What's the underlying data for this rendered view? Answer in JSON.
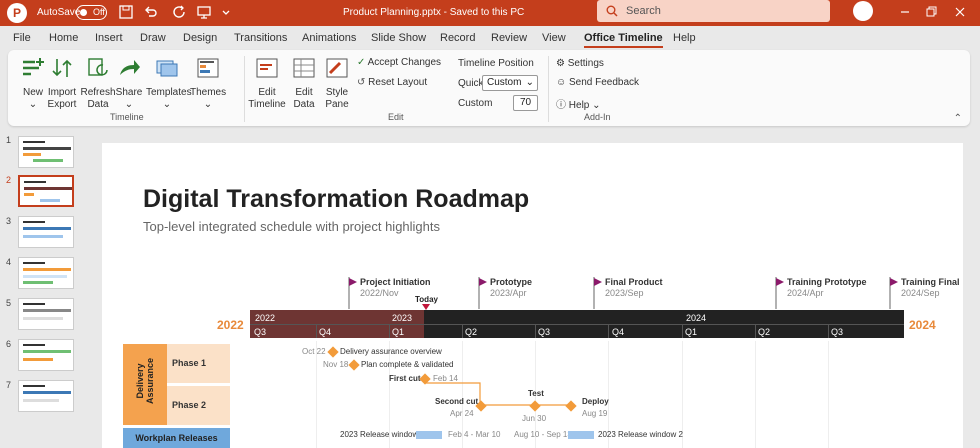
{
  "titlebar": {
    "app_letter": "P",
    "autosave_label": "AutoSave",
    "autosave_state": "Off",
    "document_title": "Product Planning.pptx - Saved to this PC",
    "search_placeholder": "Search"
  },
  "menu": [
    "File",
    "Home",
    "Insert",
    "Draw",
    "Design",
    "Transitions",
    "Animations",
    "Slide Show",
    "Record",
    "Review",
    "View",
    "Office Timeline",
    "Help"
  ],
  "active_menu": "Office Timeline",
  "ribbon": {
    "timeline_group": {
      "label": "Timeline",
      "buttons": [
        "New",
        "Import",
        "Refresh",
        "Share",
        "Templates",
        "Themes"
      ],
      "sublabels": {
        "new": "",
        "import": "Export",
        "refresh": "Data"
      }
    },
    "edit_group": {
      "label": "Edit",
      "buttons": [
        "Edit",
        "Edit",
        "Style"
      ],
      "sublabels": [
        "Timeline",
        "Data",
        "Pane"
      ],
      "accept_changes": "Accept Changes",
      "reset_layout": "Reset Layout",
      "timeline_position": "Timeline Position",
      "quick_label": "Quick",
      "quick_value": "Custom",
      "custom_label": "Custom",
      "custom_value": "70"
    },
    "addin_group": {
      "label": "Add-In",
      "settings": "Settings",
      "send_feedback": "Send Feedback",
      "help": "Help"
    }
  },
  "slides": [
    "1",
    "2",
    "3",
    "4",
    "5",
    "6",
    "7"
  ],
  "selected_slide": 2,
  "slide": {
    "title": "Digital Transformation Roadmap",
    "subtitle": "Top-level integrated schedule with project highlights",
    "milestones": [
      {
        "name": "Project Initiation",
        "date": "2022/Nov"
      },
      {
        "name": "Prototype",
        "date": "2023/Apr"
      },
      {
        "name": "Final Product",
        "date": "2023/Sep"
      },
      {
        "name": "Training Prototype",
        "date": "2024/Apr"
      },
      {
        "name": "Training Final",
        "date": "2024/Sep"
      }
    ],
    "today_label": "Today",
    "year_left": "2022",
    "year_right": "2024",
    "years": [
      "2022",
      "2023",
      "2024"
    ],
    "quarters": [
      "Q3",
      "Q4",
      "Q1",
      "Q2",
      "Q3",
      "Q4",
      "Q1",
      "Q2",
      "Q3"
    ],
    "swimlanes": [
      {
        "name": "Delivery Assurance",
        "phases": [
          "Phase 1",
          "Phase 2"
        ]
      },
      {
        "name": "Workplan Releases"
      }
    ],
    "tasks": [
      {
        "date": "Oct 22",
        "label": "Delivery assurance overview"
      },
      {
        "date": "Nov 18",
        "label": "Plan complete & validated"
      },
      {
        "date": "Feb 14",
        "label": "First cut"
      },
      {
        "date": "Apr 24",
        "label": "Second cut"
      },
      {
        "date": "Jun 30",
        "label": "Test"
      },
      {
        "date": "Aug 19",
        "label": "Deploy"
      }
    ],
    "releases": [
      {
        "label": "2023 Release window 1",
        "dates": "Feb 4 - Mar 10"
      },
      {
        "label": "2023 Release window 2",
        "dates": "Aug 10 - Sep 13"
      }
    ]
  }
}
